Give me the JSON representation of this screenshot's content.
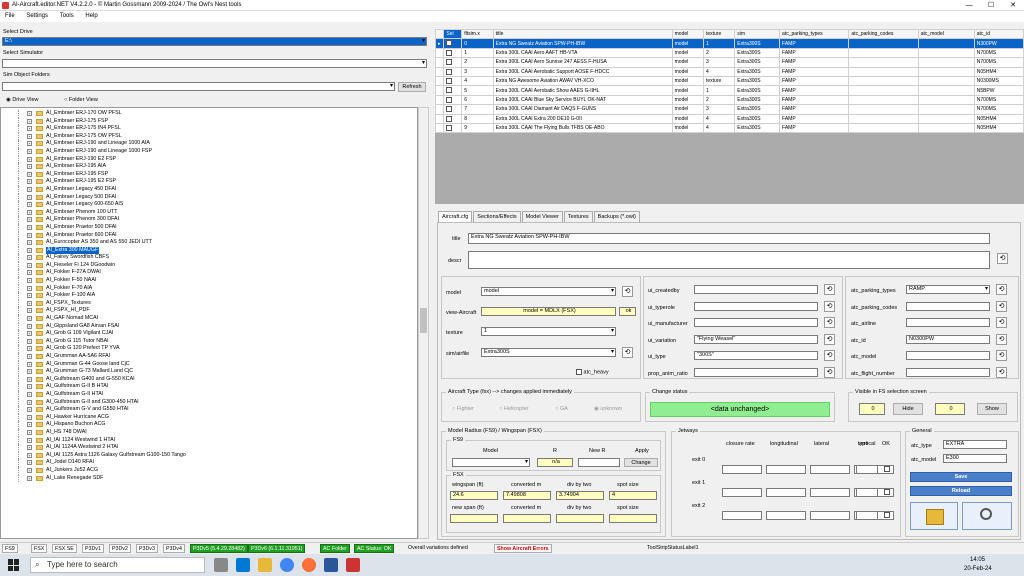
{
  "title": "AI-Aircraft.editor.NET V4.2.2.0 - © Martin Gossmann 2009-2024 / The Owl's Nest tools",
  "window_controls": {
    "min": "—",
    "max": "☐",
    "close": "✕"
  },
  "menu": [
    "File",
    "Settings",
    "Tools",
    "Help"
  ],
  "left": {
    "select_drive_label": "Select Drive",
    "drive_value": "E:\\",
    "select_sim_label": "Select Simulator",
    "sim_value": "",
    "sim_folders_label": "Sim Object Folders",
    "folder_value": "",
    "refresh": "Refresh",
    "radio_drive": "Drive View",
    "radio_folder": "Folder View",
    "tree": [
      "AI_Embraer ERJ-170 OW PFSL",
      "AI_Embraer ERJ-175 FSP",
      "AI_Embraer ERJ-175 IN4 PFSL",
      "AI_Embraer ERJ-175 OW PFSL",
      "AI_Embraer ERJ-190 and Lineage 1000 AIA",
      "AI_Embraer ERJ-190 and Lineage 1000 FSP",
      "AI_Embraer ERJ-190 E2 FSP",
      "AI_Embraer ERJ-195 AIA",
      "AI_Embraer ERJ-195 FSP",
      "AI_Embraer ERJ-195 E2 FSP",
      "AI_Embraer Legacy 450 DFAI",
      "AI_Embraer Legacy 500 DFAI",
      "AI_Embraer Legacy 600-650 AIS",
      "AI_Embraer Phenom 100 UTT",
      "AI_Embraer Phenom 300 DFAI",
      "AI_Embraer Praetor 500 DFAI",
      "AI_Embraer Praetor 600 DFAI",
      "AI_Eurocopter AS 350 and AS 550 JEDI UTT",
      "AI_Extra 300 MAUGF",
      "AI_Fairey Swordfish CBFS",
      "AI_Fieseler Fi 124 DGoodwin",
      "AI_Fokker F-27A DWAI",
      "AI_Fokker F-50 NAAI",
      "AI_Fokker F-70 AIA",
      "AI_Fokker F-100 AIA",
      "AI_FSPX_Textures",
      "AI_FSPX_HI_PDF",
      "AI_GAF Nomad MCAI",
      "AI_Gippsland GA8 Airvan FSAI",
      "AI_Grob G 109 Vigilant CJAI",
      "AI_Grob G 115 Tutor NBAI",
      "AI_Grob G 120 Prefect TP YVA",
      "AI_Grumman AA-5A6 RFAI",
      "AI_Grumman G-44 Goose land CjC",
      "AI_Grumman G-73 Mallard Land CjC",
      "AI_Gulfstream G400 and G-550 KCAI",
      "AI_Gulfstream G-II B HTAI",
      "AI_Gulfstream G-II HTAI",
      "AI_Gulfstream G-II and G300-450 HTAI",
      "AI_Gulfstream G-V and G550 HTAI",
      "AI_Hawker Hurricane ACG",
      "AI_Hispano Buchon ACG",
      "AI_HS 748 DWAI",
      "AI_IAI 1124 Westwind 1 HTAI",
      "AI_IAI 1124A Westwind 2 HTAI",
      "AI_IAI 1125 Astra 1126 Galaxy Gulfstream G100-150 Tango",
      "AI_Jodel D140 RFAI",
      "AI_Junkers Ju52 ACG",
      "AI_Lake Renegade SDF"
    ],
    "tree_selected_index": 18
  },
  "grid": {
    "columns": [
      "Sel",
      "fltsim.x",
      "title",
      "model",
      "texture",
      "sim",
      "atc_parking_types",
      "atc_parking_codes",
      "atc_model",
      "atc_id"
    ],
    "rows": [
      [
        "0",
        "Extra NG Sweatz Aviation SPW-PH-IBW",
        "model",
        "1",
        "Extra300S",
        "FAMP",
        "",
        "",
        "N300PW"
      ],
      [
        "1",
        "Extra 300L CAAI Aero AAFT HB-VTA",
        "model",
        "2",
        "Extra300S",
        "FAMP",
        "",
        "",
        "N700MS"
      ],
      [
        "2",
        "Extra 300L CAAI Aero Sunrise 247 AESS F-HUSA",
        "model",
        "3",
        "Extra300S",
        "FAMP",
        "",
        "",
        "N700MS"
      ],
      [
        "3",
        "Extra 300L CAAI Aerobatic Support AOSE F-HDCC",
        "model",
        "4",
        "Extra300S",
        "FAMP",
        "",
        "",
        "N05HM4"
      ],
      [
        "4",
        "Extra NG Awesome Aviation AWAV VH-XCO",
        "model",
        "texture",
        "Extra300S",
        "FAMP",
        "",
        "",
        "N0300MS"
      ],
      [
        "5",
        "Extra 300L CAAI Aerobatic Show AAES G-IIHL",
        "model",
        "1",
        "Extra300S",
        "FAMP",
        "",
        "",
        "N5BPW"
      ],
      [
        "6",
        "Extra 300L CAAI Blue Sky Service BUYL OK-NAT",
        "model",
        "2",
        "Extra300S",
        "FAMP",
        "",
        "",
        "N700MS"
      ],
      [
        "7",
        "Extra 300L CAAI Diamant Air DAQS F-GUNS",
        "model",
        "3",
        "Extra300S",
        "FAMP",
        "",
        "",
        "N700MS"
      ],
      [
        "8",
        "Extra 300L CAAI Extra 200 DE10 G-0II",
        "model",
        "4",
        "Extra300S",
        "FAMP",
        "",
        "",
        "N05HM4"
      ],
      [
        "9",
        "Extra 300L CAAI The Flying Bulls TFBS OE-ABO",
        "model",
        "4",
        "Extra300S",
        "FAMP",
        "",
        "",
        "N05HM4"
      ]
    ]
  },
  "tabs": [
    "Aircraft.cfg",
    "Sections/Effects",
    "Model Viewer",
    "Textures",
    "Backups (*.owl)"
  ],
  "form": {
    "title_label": "title",
    "title_value": "Extra NG Sweatz Aviation SPW-PH-IBW",
    "descr_label": "descr",
    "descr_value": "",
    "model_label": "model",
    "model_value": "model",
    "view_label": "view-Aircraft",
    "view_value": "model = MDLX (FSX)",
    "view_btn": "ok",
    "texture_label": "texture",
    "texture_value": "1",
    "sim_label": "sim/airfile",
    "sim_value": "Extra300S",
    "atc_heavy_label": "atc_heavy",
    "mid_labels": [
      "ui_createdby",
      "ui_typerole",
      "ui_manufacturer",
      "ui_variation",
      "ui_type",
      "prop_anim_ratio"
    ],
    "mid_values": [
      "",
      "",
      "",
      "\"Flying Weasel\"",
      "\"300S\"",
      ""
    ],
    "right_labels": [
      "atc_parking_types",
      "atc_parking_codes",
      "atc_airline",
      "atc_id",
      "atc_model",
      "atc_flight_number"
    ],
    "right_values": [
      "RAMP",
      "",
      "",
      "N0300PW",
      "",
      ""
    ],
    "aircraft_type_label": "Aircraft Type (fsx) --> changes applied immediately",
    "aircraft_types": [
      "Fighter",
      "Helicopter",
      "GA",
      "unknown"
    ],
    "change_status_label": "Change status",
    "change_status": "<data unchanged>",
    "visible_label": "Visible in FS selection screen",
    "visible_a": "0",
    "hide": "Hide",
    "visible_b": "0",
    "show": "Show"
  },
  "model_radius": {
    "title": "Model Radius (FS9) / Wingspan (FSX)",
    "fs9_label": "FS9",
    "fs9_headers": [
      "Model",
      "R",
      "New R",
      "Apply"
    ],
    "fs9_r": "n/a",
    "change": "Change",
    "fsx_label": "FSX",
    "fsx_headers": [
      "wingspan (ft)",
      "converted m",
      "div by two",
      "spot size"
    ],
    "fsx_values": [
      "24.6",
      "7.49808",
      "3.74904",
      "4"
    ],
    "fsx_headers2": [
      "new span (ft)",
      "converted m",
      "div by two",
      "spot size"
    ]
  },
  "jetways": {
    "title": "Jetways",
    "headers": [
      "closure rate",
      "longitudinal",
      "lateral",
      "vertical",
      "type",
      "OK"
    ],
    "rows": [
      "exit 0",
      "exit 1",
      "exit 2"
    ]
  },
  "general": {
    "title": "General",
    "atc_type_label": "atc_type",
    "atc_type_value": "EXTRA",
    "atc_model_label": "atc_model",
    "atc_model_value": "E300",
    "save": "Save",
    "reload": "Reload"
  },
  "status": [
    "FS9",
    "FSX",
    "FSX SE",
    "P3Dv1",
    "P3Dv2",
    "P3Dv3",
    "P3Dv4",
    "P3Dv5 (5.4.29.28482)",
    "P3Dv6 (6.1.11.31951)",
    "AC Folder",
    "AC Status: OK",
    "Overall variations defined",
    "Show Aircraft Errors",
    "ToolStripStatusLabel1"
  ],
  "taskbar": {
    "search": "Type here to search",
    "time": "14:05",
    "date": "20-Feb-24"
  }
}
